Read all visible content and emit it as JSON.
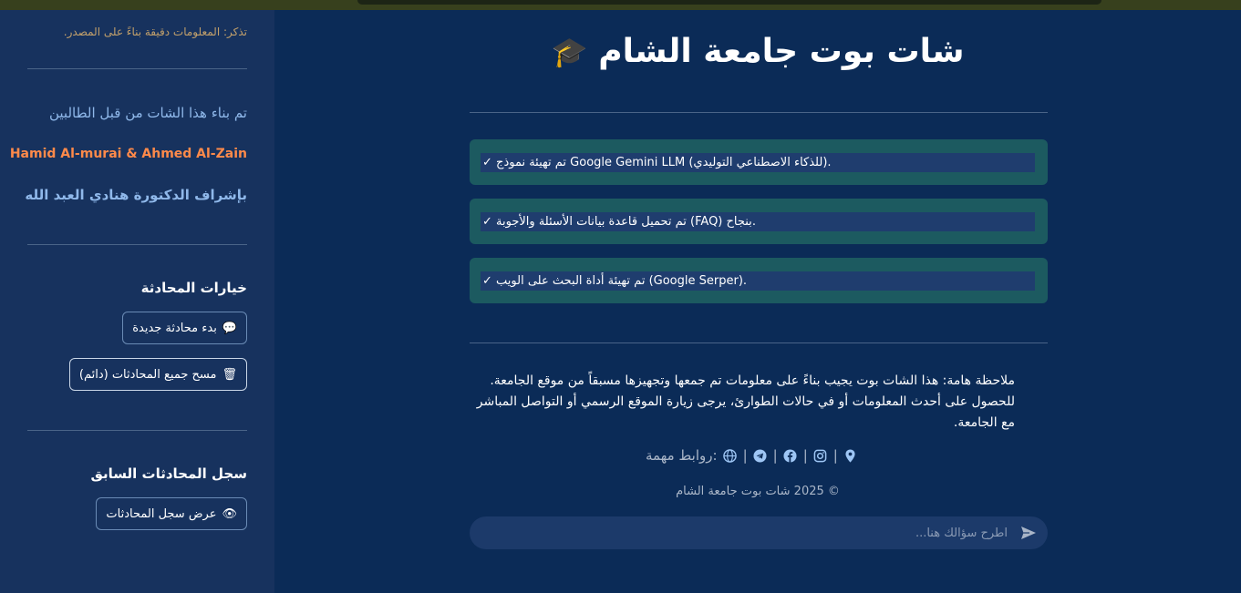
{
  "sidebar": {
    "note": "تذكر: المعلومات دقيقة بناءً على المصدر.",
    "credit_intro": "تم بناء هذا الشات من قبل الطالبين",
    "credit_names": "Hamid Al-murai & Ahmed Al-Zain",
    "credit_supervisor": "بإشراف الدكتورة هنادي العبد الله",
    "options_heading": "خيارات المحادثة",
    "new_chat_label": "بدء محادثة جديدة",
    "clear_all_label": "مسح جميع المحادثات (دائم)",
    "history_heading": "سجل المحادثات السابق",
    "view_history_label": "عرض سجل المحادثات"
  },
  "main": {
    "title": "شات بوت جامعة الشام",
    "status_messages": [
      "تم تهيئة نموذج Google Gemini LLM (للذكاء الاصطناعي التوليدي).",
      "تم تحميل قاعدة بيانات الأسئلة والأجوبة (FAQ) بنجاح.",
      "تم تهيئة أداة البحث على الويب (Google Serper)."
    ],
    "check_mark": "✓",
    "notice": "ملاحظة هامة: هذا الشات بوت يجيب بناءً على معلومات تم جمعها وتجهيزها مسبقاً من موقع الجامعة. للحصول على أحدث المعلومات أو في حالات الطوارئ، يرجى زيارة الموقع الرسمي أو التواصل المباشر مع الجامعة.",
    "links_label": "روابط مهمة:",
    "copyright": "© 2025 شات بوت جامعة الشام",
    "chat_placeholder": "اطرح سؤالك هنا..."
  },
  "colors": {
    "background": "#0b2b57",
    "sidebar": "#17325e",
    "status_box": "#1c5a60",
    "accent_orange": "#ff8a4a",
    "accent_blue": "#8fb8ea"
  },
  "icons": [
    "graduation-cap-icon",
    "speech-bubble-icon",
    "trash-icon",
    "eye-icon",
    "map-pin-icon",
    "instagram-icon",
    "facebook-icon",
    "telegram-icon",
    "globe-icon",
    "send-icon"
  ]
}
